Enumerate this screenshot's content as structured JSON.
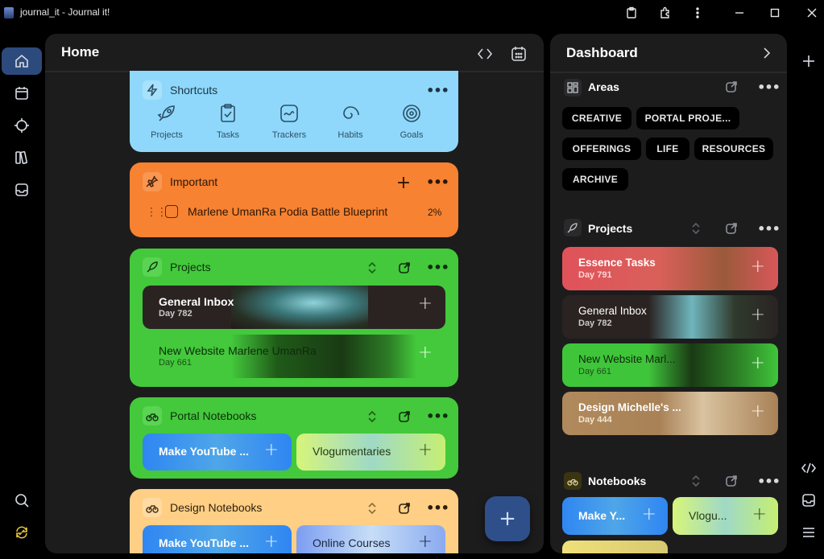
{
  "window": {
    "title": "journal_it - Journal it!"
  },
  "main": {
    "title": "Home",
    "shortcuts": {
      "title": "Shortcuts",
      "items": [
        {
          "label": "Projects",
          "icon": "rocket-icon"
        },
        {
          "label": "Tasks",
          "icon": "clipboard-check-icon"
        },
        {
          "label": "Trackers",
          "icon": "chart-icon"
        },
        {
          "label": "Habits",
          "icon": "spiral-icon"
        },
        {
          "label": "Goals",
          "icon": "target-icon"
        }
      ]
    },
    "important": {
      "title": "Important",
      "item": {
        "label": "Marlene UmanRa Podia Battle Blueprint",
        "progress": "2%"
      }
    },
    "projects": {
      "title": "Projects",
      "items": [
        {
          "name": "General Inbox",
          "day": "Day 782"
        },
        {
          "name": "New Website Marlene UmanRa",
          "day": "Day 661"
        }
      ]
    },
    "portal_notebooks": {
      "title": "Portal Notebooks",
      "items": [
        {
          "name": "Make YouTube ..."
        },
        {
          "name": "Vlogumentaries"
        }
      ]
    },
    "design_notebooks": {
      "title": "Design Notebooks",
      "items": [
        {
          "name": "Make YouTube ..."
        },
        {
          "name": "Online Courses"
        }
      ]
    },
    "fab_label": "+"
  },
  "dashboard": {
    "title": "Dashboard",
    "areas": {
      "title": "Areas",
      "chips": [
        "CREATIVE",
        "PORTAL PROJE...",
        "OFFERINGS",
        "LIFE",
        "RESOURCES",
        "ARCHIVE"
      ]
    },
    "projects": {
      "title": "Projects",
      "items": [
        {
          "name": "Essence Tasks",
          "day": "Day 791"
        },
        {
          "name": "General Inbox",
          "day": "Day 782"
        },
        {
          "name": "New Website Marl...",
          "day": "Day 661"
        },
        {
          "name": "Design Michelle's ...",
          "day": "Day 444"
        }
      ]
    },
    "notebooks": {
      "title": "Notebooks",
      "items": [
        {
          "name": "Make Y..."
        },
        {
          "name": "Vlogu..."
        }
      ]
    }
  },
  "colors": {
    "shortcuts_card": "#8fd8fb",
    "important_card": "#f78231",
    "projects_card": "#43c93b",
    "design_card": "#ffcf86",
    "rail_active": "#2d4a7c",
    "essence": "#e0525a",
    "general_inbox": "#2a2322",
    "new_website": "#3fc53a",
    "design_michelle": "#b08a5c"
  }
}
